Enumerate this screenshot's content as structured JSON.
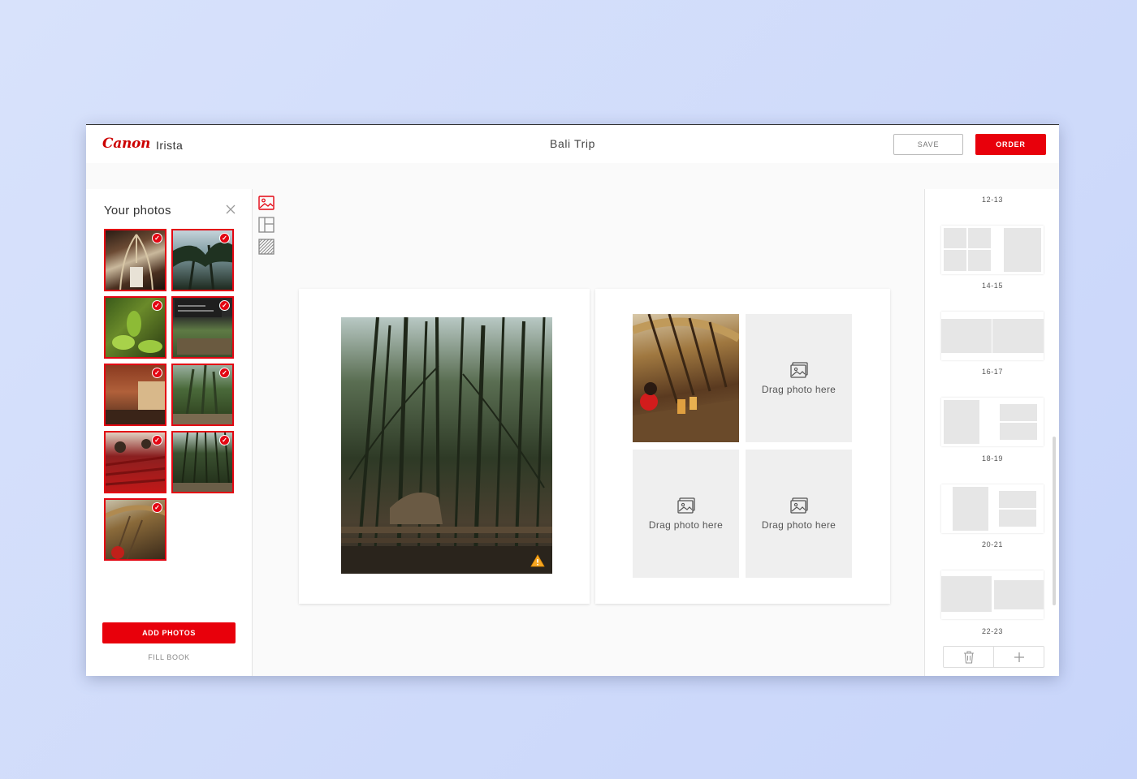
{
  "header": {
    "brand": "Canon",
    "product": "Irista",
    "title": "Bali Trip",
    "save_label": "SAVE",
    "order_label": "ORDER"
  },
  "photos_panel": {
    "title": "Your photos",
    "add_label": "ADD PHOTOS",
    "fill_label": "FILL BOOK"
  },
  "editor": {
    "slot_label": "Drag photo here"
  },
  "spreads": {
    "labels": [
      "12-13",
      "14-15",
      "16-17",
      "18-19",
      "20-21",
      "22-23"
    ]
  },
  "colors": {
    "accent": "#e8000b",
    "slot": "#efefef"
  },
  "icons": [
    "close-icon",
    "check-icon",
    "photo-tool-icon",
    "layout-tool-icon",
    "background-tool-icon",
    "warning-icon",
    "image-placeholder-icon",
    "trash-icon",
    "plus-icon"
  ]
}
